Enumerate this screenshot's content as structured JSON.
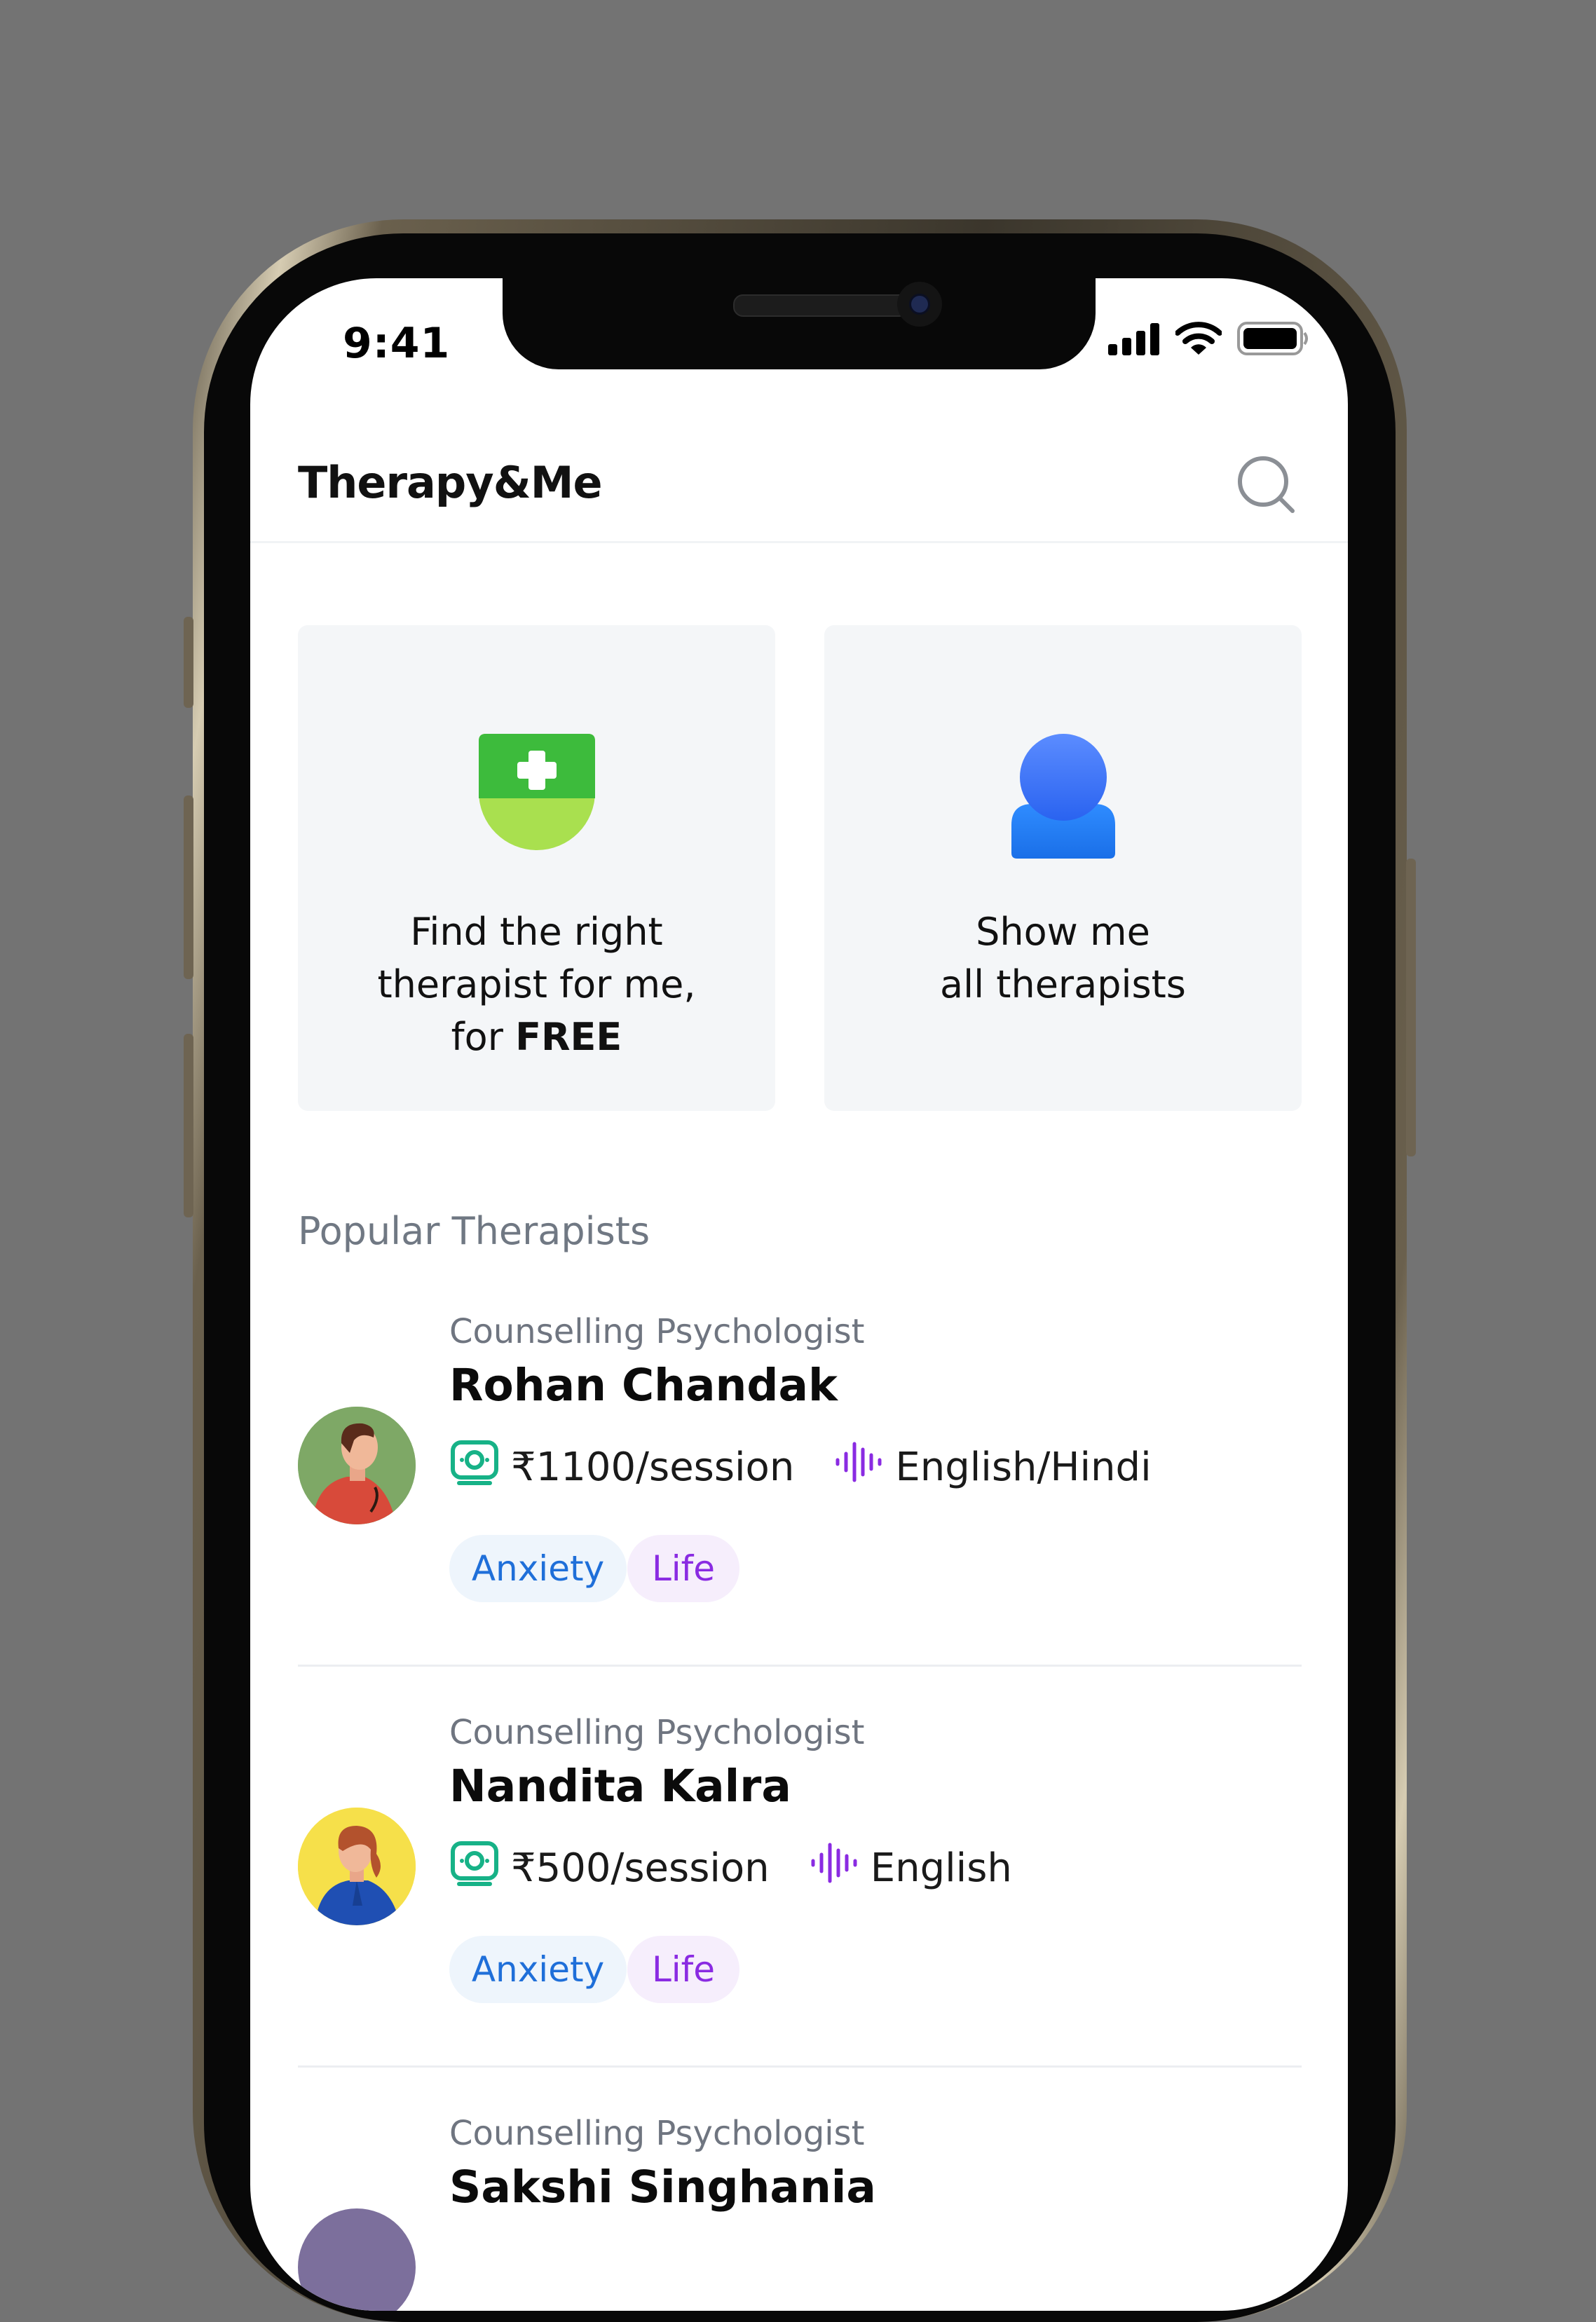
{
  "status_bar": {
    "time": "9:41"
  },
  "header": {
    "title": "Therapy&Me",
    "search_icon": "search-icon"
  },
  "cards": [
    {
      "id": "find",
      "icon": "shield-plus-icon",
      "line1": "Find the right",
      "line2": "therapist for me,",
      "line3_prefix": "for ",
      "line3_bold": "FREE"
    },
    {
      "id": "all",
      "icon": "person-icon",
      "line1": "Show me",
      "line2": "all therapists"
    }
  ],
  "section_title": "Popular Therapists",
  "therapists": [
    {
      "role": "Counselling Psychologist",
      "name": "Rohan Chandak",
      "price": "₹1100/session",
      "language": "English/Hindi",
      "tags": [
        "Anxiety",
        "Life"
      ]
    },
    {
      "role": "Counselling Psychologist",
      "name": "Nandita Kalra",
      "price": "₹500/session",
      "language": "English",
      "tags": [
        "Anxiety",
        "Life"
      ]
    },
    {
      "role": "Counselling Psychologist",
      "name": "Sakshi Singhania"
    }
  ],
  "colors": {
    "background": "#737373",
    "price_icon": "#17b287",
    "language_icon": "#8a2be2",
    "tag_anxiety_text": "#1f6fd9",
    "tag_life_text": "#8a2be2"
  }
}
